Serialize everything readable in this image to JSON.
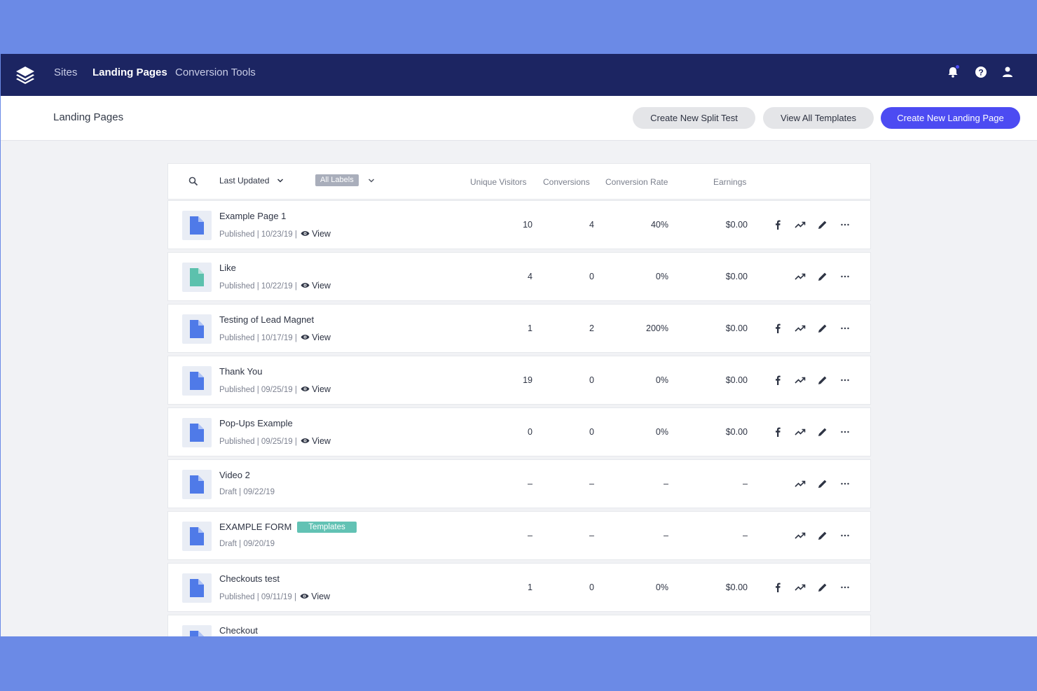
{
  "nav": {
    "links": [
      "Sites",
      "Landing Pages",
      "Conversion Tools"
    ]
  },
  "subheader": {
    "title": "Landing Pages",
    "split_test_label": "Create New Split Test",
    "templates_label": "View All Templates",
    "create_label": "Create New Landing Page"
  },
  "toolbar": {
    "sort_label": "Last Updated",
    "labels_filter": "All Labels"
  },
  "columns": {
    "visitors": "Unique Visitors",
    "conversions": "Conversions",
    "rate": "Conversion Rate",
    "earnings": "Earnings"
  },
  "rows": [
    {
      "title": "Example Page 1",
      "status": "Published",
      "date": "10/23/19",
      "view": "View",
      "visitors": "10",
      "conversions": "4",
      "rate": "40%",
      "earnings": "$0.00"
    },
    {
      "title": "Like",
      "status": "Published",
      "date": "10/22/19",
      "view": "View",
      "visitors": "4",
      "conversions": "0",
      "rate": "0%",
      "earnings": "$0.00"
    },
    {
      "title": "Testing of Lead Magnet",
      "status": "Published",
      "date": "10/17/19",
      "view": "View",
      "visitors": "1",
      "conversions": "2",
      "rate": "200%",
      "earnings": "$0.00"
    },
    {
      "title": "Thank You",
      "status": "Published",
      "date": "09/25/19",
      "view": "View",
      "visitors": "19",
      "conversions": "0",
      "rate": "0%",
      "earnings": "$0.00"
    },
    {
      "title": "Pop-Ups Example",
      "status": "Published",
      "date": "09/25/19",
      "view": "View",
      "visitors": "0",
      "conversions": "0",
      "rate": "0%",
      "earnings": "$0.00"
    },
    {
      "title": "Video 2",
      "status": "Draft",
      "date": "09/22/19",
      "visitors": "–",
      "conversions": "–",
      "rate": "–",
      "earnings": "–"
    },
    {
      "title": "EXAMPLE FORM",
      "tag": "Templates",
      "status": "Draft",
      "date": "09/20/19",
      "visitors": "–",
      "conversions": "–",
      "rate": "–",
      "earnings": "–"
    },
    {
      "title": "Checkouts test",
      "status": "Published",
      "date": "09/11/19",
      "view": "View",
      "visitors": "1",
      "conversions": "0",
      "rate": "0%",
      "earnings": "$0.00"
    },
    {
      "title": "Checkout"
    }
  ],
  "colors": {
    "nav_bg": "#1c2562",
    "primary": "#4c4bf2",
    "page_icon": "#4f7ae8",
    "page_icon_alt": "#5cc1ad",
    "tag": "#62c2b4",
    "frame": "#6b8ae6"
  }
}
